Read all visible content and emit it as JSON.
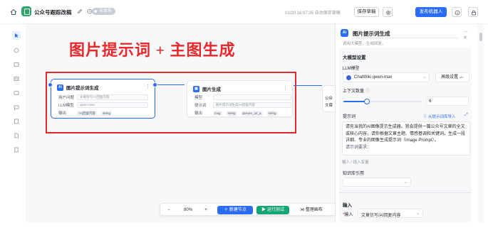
{
  "header": {
    "app_title": "公众号跟踪改稿",
    "status": "未发布",
    "save_time": "01/20 16:07:35 自动保存草稿",
    "save_label": "保存草稿",
    "publish_label": "发布机器人"
  },
  "canvas": {
    "annotation": "图片提示词 + 主图生成",
    "node1": {
      "title": "图片提示词生成",
      "rows": [
        {
          "label": "用户问题",
          "value": "文章仿写/AI回复内容"
        },
        {
          "label": "LLM模型",
          "value": "qwen-max"
        }
      ],
      "output_label": "输出",
      "output_chips": [
        "*AI回复内容",
        "string"
      ]
    },
    "node2": {
      "title": "图片生成",
      "rows": [
        {
          "label": "模型",
          "value": ""
        },
        {
          "label": "提示词",
          "value": "图片提示词生成/AI回复内容"
        }
      ],
      "output_label": "输出",
      "output_chips": [
        "msg",
        "string",
        "picture_url_a",
        "string"
      ]
    },
    "stub": {
      "line1": "公众",
      "line2": "文章"
    }
  },
  "toolbar": {
    "zoom_out": "−",
    "zoom": "80%",
    "zoom_in": "+",
    "add_node": "新建节点",
    "run_test": "运行测试",
    "arrange": "整理画布"
  },
  "panel": {
    "title": "图片提示词生成",
    "desc": "调用大模型，生成回复。",
    "settings_title": "大模型设置",
    "llm_label": "LLM模型",
    "model_name": "ChatWiki qwen-max",
    "advanced_label": "高级设置",
    "context_label": "上下文数量",
    "context_value": "6",
    "context_fraction": 0.3,
    "prompt_label": "提示词",
    "import_link": "从提示词库导入",
    "prompt_text": "请充当我的AI图像提示生成器。我会提供一篇公众号文章的全文或核心内容，请你根据文章主题、情感基调和关键词，生成一段详细、专业的图像生成提示词（Image Prompt）。",
    "prompt_more": "请示词要求：",
    "input_vars_hint": "输入 / 插入变量",
    "kb_label": "知识库引用",
    "input_section": "输入",
    "input_field_label": "输入",
    "input_field_value": "文章仿写/AI回复内容"
  },
  "colors": {
    "accent": "#2a6cf6",
    "annotation_red": "#e5262a",
    "run_green": "#15a672"
  }
}
